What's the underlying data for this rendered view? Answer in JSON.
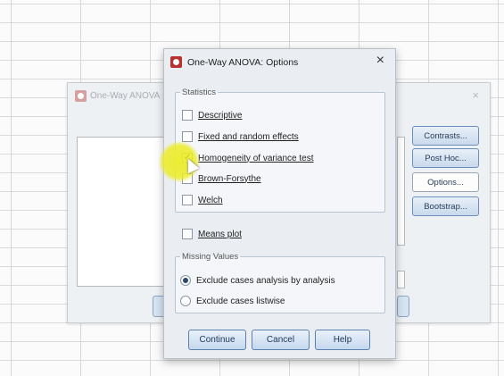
{
  "parent_dialog": {
    "title": "One-Way ANOVA",
    "close_glyph": "×",
    "side_buttons": [
      "Contrasts...",
      "Post Hoc...",
      "Options...",
      "Bootstrap..."
    ]
  },
  "options_dialog": {
    "title": "One-Way ANOVA: Options",
    "close_glyph": "×",
    "statistics": {
      "legend": "Statistics",
      "items": [
        {
          "label": "Descriptive",
          "checked": false
        },
        {
          "label": "Fixed and random effects",
          "checked": false
        },
        {
          "label": "Homogeneity of variance test",
          "checked": true
        },
        {
          "label": "Brown-Forsythe",
          "checked": false
        },
        {
          "label": "Welch",
          "checked": false
        }
      ]
    },
    "means_plot": {
      "label": "Means plot",
      "checked": false
    },
    "missing_values": {
      "legend": "Missing Values",
      "options": [
        {
          "label": "Exclude cases analysis by analysis",
          "selected": true
        },
        {
          "label": "Exclude cases listwise",
          "selected": false
        }
      ]
    },
    "buttons": {
      "continue": "Continue",
      "cancel": "Cancel",
      "help": "Help"
    }
  },
  "icons": {
    "app": "spss-app-icon",
    "check": "✔"
  },
  "colors": {
    "highlight": "#ecec28",
    "button_border": "#5c80ad",
    "dialog_bg": "#eaeef3"
  }
}
